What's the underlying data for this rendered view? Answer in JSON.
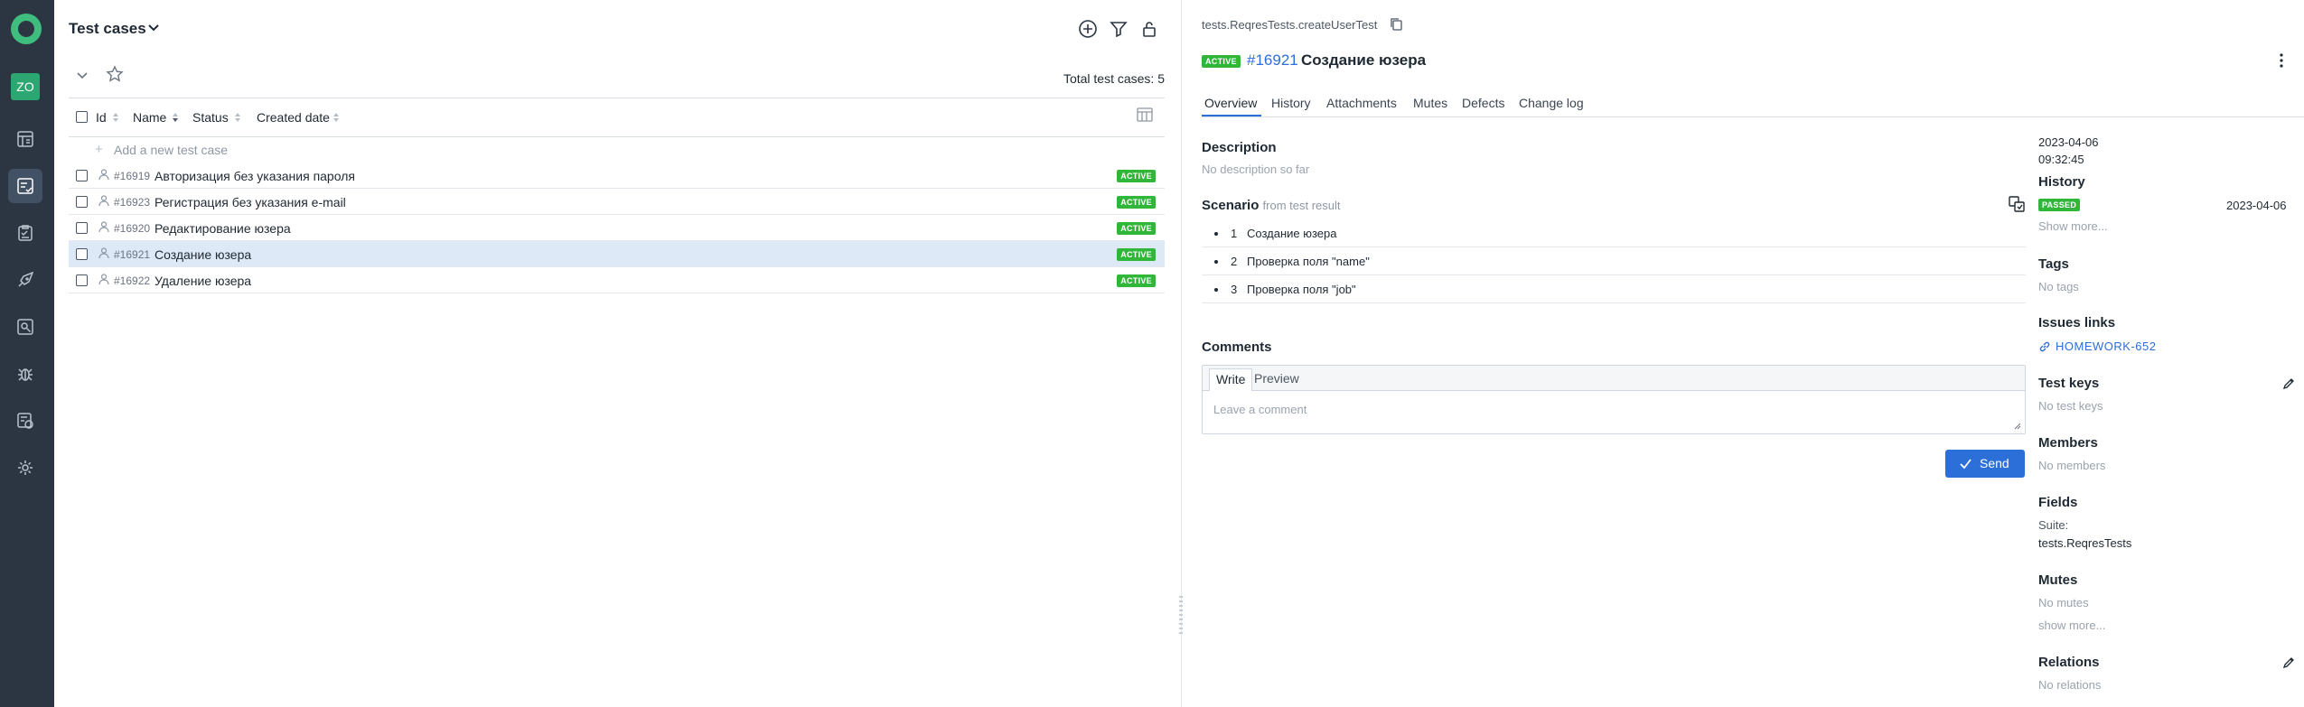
{
  "sidebar": {
    "avatar_initials": "ZO",
    "items": [
      {
        "icon": "dashboard-icon"
      },
      {
        "icon": "test-cases-icon",
        "active": true
      },
      {
        "icon": "test-plans-icon"
      },
      {
        "icon": "launches-icon"
      },
      {
        "icon": "search-icon"
      },
      {
        "icon": "defects-bug-icon"
      },
      {
        "icon": "jobs-icon"
      },
      {
        "icon": "settings-gear-icon"
      }
    ]
  },
  "list": {
    "title": "Test cases",
    "total": "Total test cases: 5",
    "columns": {
      "id": "Id",
      "name": "Name",
      "status": "Status",
      "created": "Created date"
    },
    "add_new": "Add a new test case",
    "rows": [
      {
        "id": "#16919",
        "name": "Авторизация без указания пароля",
        "status": "ACTIVE"
      },
      {
        "id": "#16923",
        "name": "Регистрация без указания e-mail",
        "status": "ACTIVE"
      },
      {
        "id": "#16920",
        "name": "Редактирование юзера",
        "status": "ACTIVE"
      },
      {
        "id": "#16921",
        "name": "Создание юзера",
        "status": "ACTIVE",
        "selected": true
      },
      {
        "id": "#16922",
        "name": "Удаление юзера",
        "status": "ACTIVE"
      }
    ]
  },
  "detail": {
    "breadcrumb": "tests.ReqresTests.createUserTest",
    "status": "ACTIVE",
    "id": "#16921",
    "name": "Создание юзера",
    "tabs": [
      "Overview",
      "History",
      "Attachments",
      "Mutes",
      "Defects",
      "Change log"
    ],
    "active_tab": "Overview",
    "description_title": "Description",
    "description_empty": "No description so far",
    "scenario_title": "Scenario",
    "scenario_sub": "from test result",
    "steps": [
      {
        "num": "1",
        "text": "Создание юзера"
      },
      {
        "num": "2",
        "text": "Проверка поля \"name\""
      },
      {
        "num": "3",
        "text": "Проверка поля \"job\""
      }
    ],
    "comments_title": "Comments",
    "comment_tabs": {
      "write": "Write",
      "preview": "Preview"
    },
    "comment_placeholder": "Leave a comment",
    "send_label": "Send"
  },
  "sidepanel": {
    "date": "2023-04-06",
    "time": "09:32:45",
    "history_title": "History",
    "history_status": "PASSED",
    "history_date": "2023-04-06",
    "show_more": "Show more...",
    "tags_title": "Tags",
    "tags_empty": "No tags",
    "issues_title": "Issues links",
    "issue_link": "HOMEWORK-652",
    "test_keys_title": "Test keys",
    "test_keys_empty": "No test keys",
    "members_title": "Members",
    "members_empty": "No members",
    "fields_title": "Fields",
    "fields_suite_label": "Suite:",
    "fields_suite_value": "tests.ReqresTests",
    "mutes_title": "Mutes",
    "mutes_empty": "No mutes",
    "mutes_show_more": "show more...",
    "relations_title": "Relations",
    "relations_empty": "No relations"
  },
  "colors": {
    "sidebar_bg": "#2b3642",
    "accent": "#2d6fd8",
    "active_badge": "#30b73a",
    "passed_badge": "#30b73a",
    "selected_row": "#dde9f7"
  }
}
